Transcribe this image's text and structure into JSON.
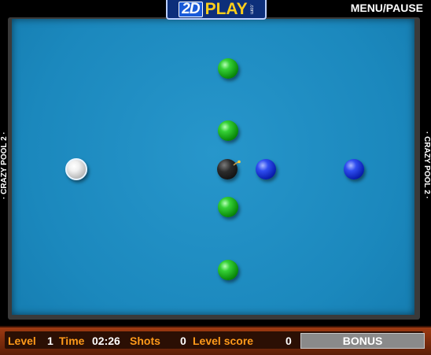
{
  "header": {
    "logo_2d": "2D",
    "logo_play": "PLAY",
    "logo_com": ".com",
    "menu_label": "MENU/PAUSE"
  },
  "sides": {
    "left_text": "· CRAZY POOL 2 ·",
    "right_text": "· CRAZY POOL 2 ·"
  },
  "balls": [
    {
      "type": "green"
    },
    {
      "type": "green"
    },
    {
      "type": "green"
    },
    {
      "type": "green"
    },
    {
      "type": "white"
    },
    {
      "type": "bomb"
    },
    {
      "type": "blue"
    },
    {
      "type": "blue"
    }
  ],
  "status": {
    "level_label": "Level",
    "level_value": "1",
    "time_label": "Time",
    "time_value": "02:26",
    "shots_label": "Shots",
    "shots_value": "0",
    "score_label": "Level score",
    "score_value": "0",
    "bonus_label": "BONUS"
  },
  "colors": {
    "felt": "#1f8fc4",
    "label_orange": "#ff9a1a",
    "bar_brown": "#5b1e07"
  }
}
